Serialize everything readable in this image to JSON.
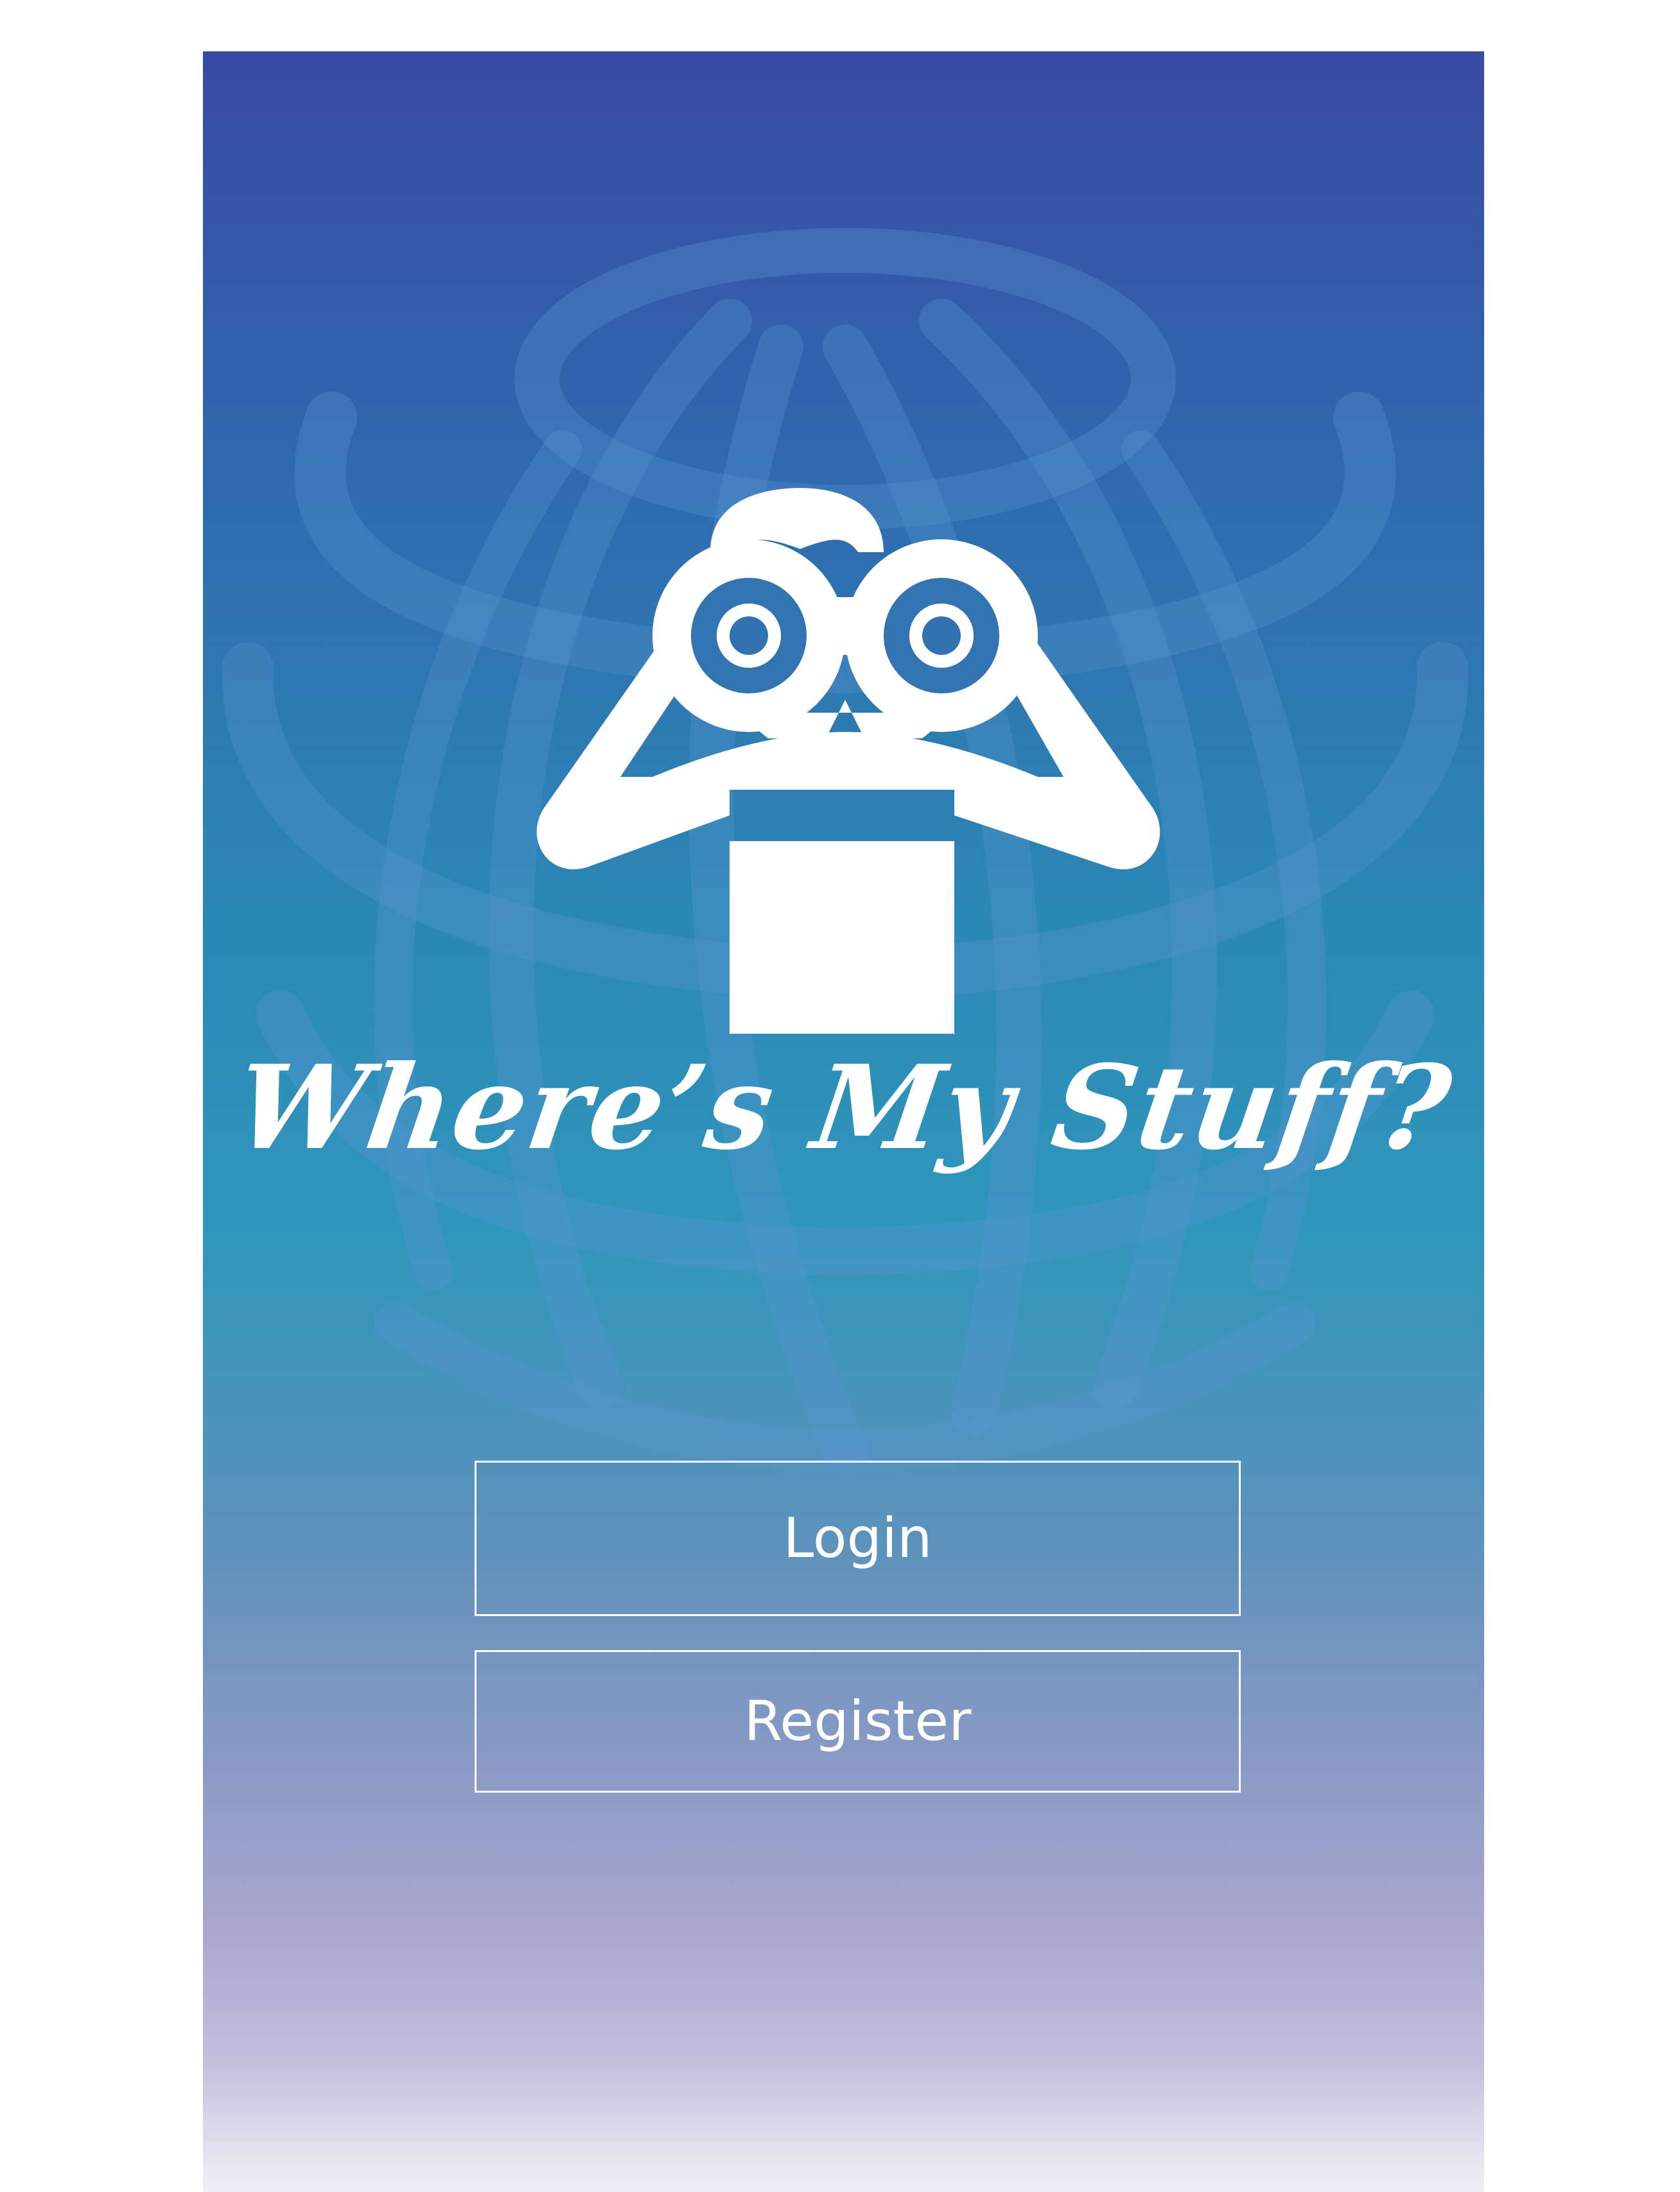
{
  "app": {
    "title": "Where’s My Stuff?"
  },
  "actions": {
    "login_label": "Login",
    "register_label": "Register"
  },
  "icons": {
    "background": "globe-icon",
    "mascot": "binoculars-person-icon"
  },
  "colors": {
    "gradient_top": "#394aa3",
    "gradient_mid": "#2b87b6",
    "gradient_bottom": "#f2f0f6",
    "foreground": "#ffffff"
  }
}
